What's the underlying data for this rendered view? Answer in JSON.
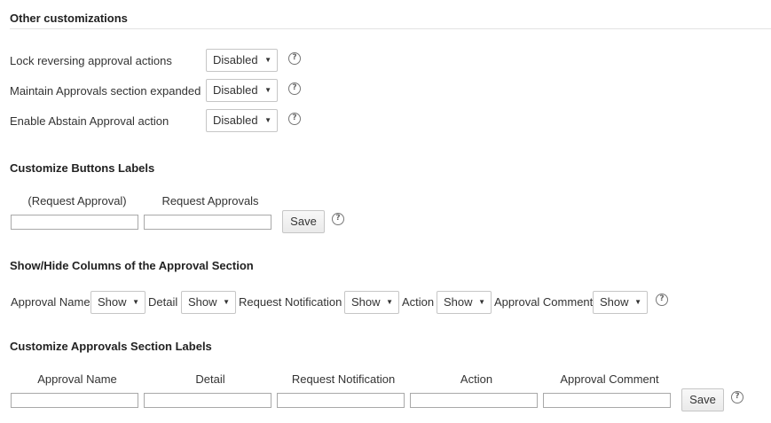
{
  "sections": {
    "other_title": "Other customizations",
    "buttons_title": "Customize Buttons Labels",
    "columns_title": "Show/Hide Columns of the Approval Section",
    "labels_title": "Customize Approvals Section Labels"
  },
  "settings": [
    {
      "label": "Lock reversing approval actions",
      "value": "Disabled"
    },
    {
      "label": "Maintain Approvals section expanded",
      "value": "Disabled"
    },
    {
      "label": "Enable Abstain Approval action",
      "value": "Disabled"
    }
  ],
  "buttons_labels": {
    "fields": [
      "(Request Approval)",
      "Request Approvals"
    ],
    "save_label": "Save"
  },
  "columns": [
    {
      "label": "Approval Name",
      "value": "Show"
    },
    {
      "label": "Detail",
      "value": "Show"
    },
    {
      "label": "Request Notification",
      "value": "Show"
    },
    {
      "label": "Action",
      "value": "Show"
    },
    {
      "label": "Approval Comment",
      "value": "Show"
    }
  ],
  "section_labels": {
    "fields": [
      "Approval Name",
      "Detail",
      "Request Notification",
      "Action",
      "Approval Comment"
    ],
    "save_label": "Save"
  },
  "icons": {
    "help": "question-mark-circle-icon",
    "dropdown": "caret-down-icon"
  },
  "glyphs": {
    "help": "?",
    "caret": "▼"
  }
}
